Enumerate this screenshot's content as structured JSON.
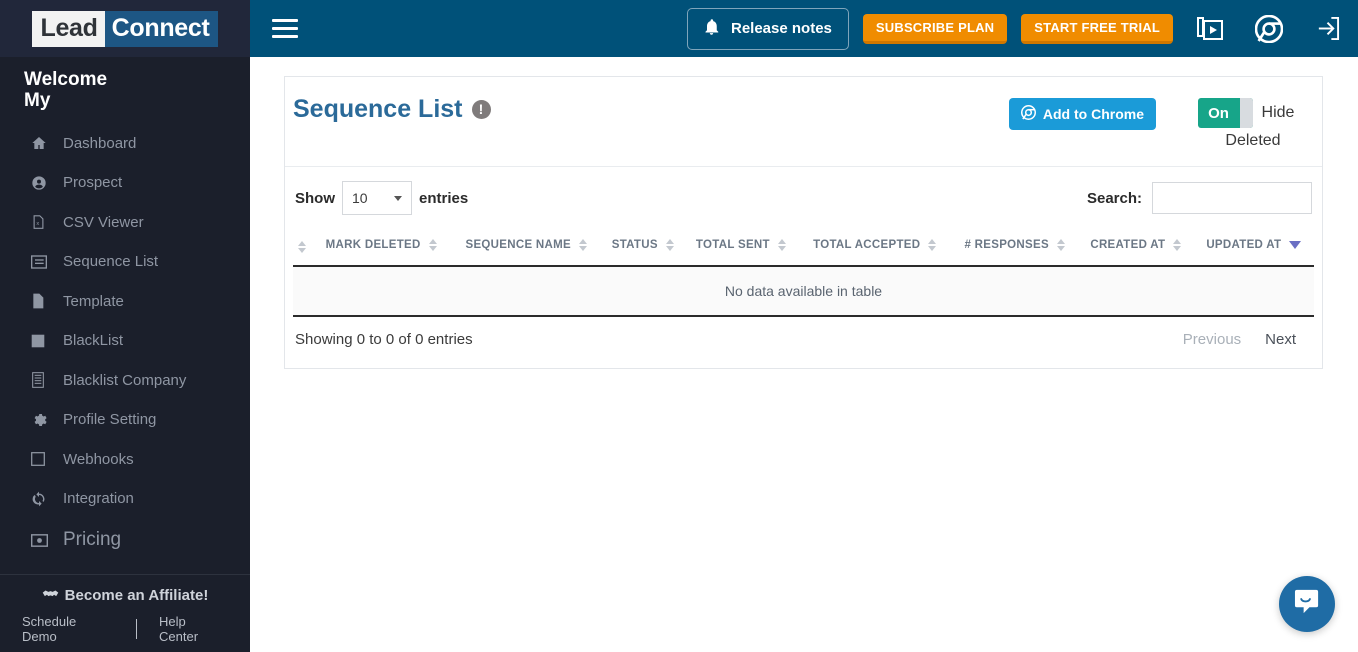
{
  "sidebar": {
    "logo": {
      "part1": "Lead",
      "part2": "Connect"
    },
    "welcome_line1": "Welcome",
    "welcome_line2": "My",
    "items": [
      {
        "label": "Dashboard",
        "icon": "home-icon"
      },
      {
        "label": "Prospect",
        "icon": "user-circle-icon"
      },
      {
        "label": "CSV Viewer",
        "icon": "file-excel-icon"
      },
      {
        "label": "Sequence List",
        "icon": "list-icon"
      },
      {
        "label": "Template",
        "icon": "file-icon"
      },
      {
        "label": "BlackList",
        "icon": "square-icon"
      },
      {
        "label": "Blacklist Company",
        "icon": "building-icon"
      },
      {
        "label": "Profile Setting",
        "icon": "gear-icon"
      },
      {
        "label": "Webhooks",
        "icon": "square-outline-icon"
      },
      {
        "label": "Integration",
        "icon": "refresh-icon"
      },
      {
        "label": "Pricing",
        "icon": "money-icon"
      }
    ],
    "affiliate": {
      "label": "Become an Affiliate!",
      "icon": "handshake-icon"
    },
    "schedule_demo": "Schedule Demo",
    "help_center": "Help Center"
  },
  "topbar": {
    "menu_icon": "hamburger-icon",
    "release_notes": {
      "label": "Release notes",
      "icon": "bell-icon"
    },
    "subscribe_plan": "SUBSCRIBE PLAN",
    "start_free_trial": "START FREE TRIAL",
    "icons": [
      "video-playlist-icon",
      "chrome-icon",
      "logout-icon"
    ],
    "bg_color": "#005179",
    "orange_color": "#f08c00"
  },
  "card": {
    "title": "Sequence List",
    "info_icon": "!",
    "add_to_chrome": "Add to Chrome",
    "toggle": {
      "state": "On",
      "label_line1": "Hide",
      "label_line2": "Deleted",
      "on_color": "#17a589"
    }
  },
  "table_controls": {
    "show_label": "Show",
    "entries_label": "entries",
    "page_length": "10",
    "search_label": "Search:",
    "search_value": "",
    "search_placeholder": ""
  },
  "table": {
    "columns": [
      {
        "label": "",
        "sort": "none"
      },
      {
        "label": "MARK DELETED",
        "sort": "none"
      },
      {
        "label": "SEQUENCE NAME",
        "sort": "none"
      },
      {
        "label": "STATUS",
        "sort": "none"
      },
      {
        "label": "TOTAL SENT",
        "sort": "none"
      },
      {
        "label": "TOTAL ACCEPTED",
        "sort": "none"
      },
      {
        "label": "# RESPONSES",
        "sort": "none"
      },
      {
        "label": "CREATED AT",
        "sort": "none"
      },
      {
        "label": "UPDATED AT",
        "sort": "desc"
      }
    ],
    "rows": [],
    "empty_message": "No data available in table"
  },
  "footer": {
    "info": "Showing 0 to 0 of 0 entries",
    "previous": "Previous",
    "next": "Next"
  },
  "chat": {
    "icon": "chat-bubble-icon"
  }
}
